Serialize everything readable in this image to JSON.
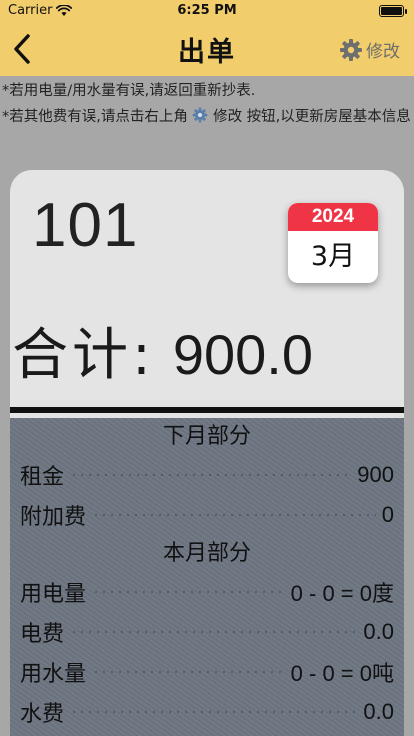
{
  "status_bar": {
    "carrier": "Carrier",
    "time": "6:25 PM"
  },
  "nav": {
    "title": "出单",
    "edit_label": "修改"
  },
  "notes": [
    "*若用电量/用水量有误,请返回重新抄表.",
    "*若其他费有误,请点击右上角",
    "修改 按钮,以更新房屋基本信息"
  ],
  "card": {
    "room": "101",
    "calendar": {
      "year": "2024",
      "month": "3月"
    },
    "total_label": "合计:",
    "total_value": "900.0"
  },
  "next_month": {
    "title": "下月部分",
    "rows": [
      {
        "label": "租金",
        "value": "900"
      },
      {
        "label": "附加费",
        "value": "0"
      }
    ]
  },
  "this_month": {
    "title": "本月部分",
    "rows": [
      {
        "label": "用电量",
        "value": "0 - 0 = 0度"
      },
      {
        "label": "电费",
        "value": "0.0"
      },
      {
        "label": "用水量",
        "value": "0 - 0 = 0吨"
      },
      {
        "label": "水费",
        "value": "0.0"
      }
    ]
  },
  "colors": {
    "header_bg": "#f2cd6c",
    "page_bg": "#a7a7a7",
    "calendar_red": "#ee3445",
    "details_bg": "#6d7682"
  },
  "icons": {
    "back": "chevron-left-icon",
    "settings": "gear-icon",
    "wifi": "wifi-icon",
    "battery": "battery-icon"
  }
}
